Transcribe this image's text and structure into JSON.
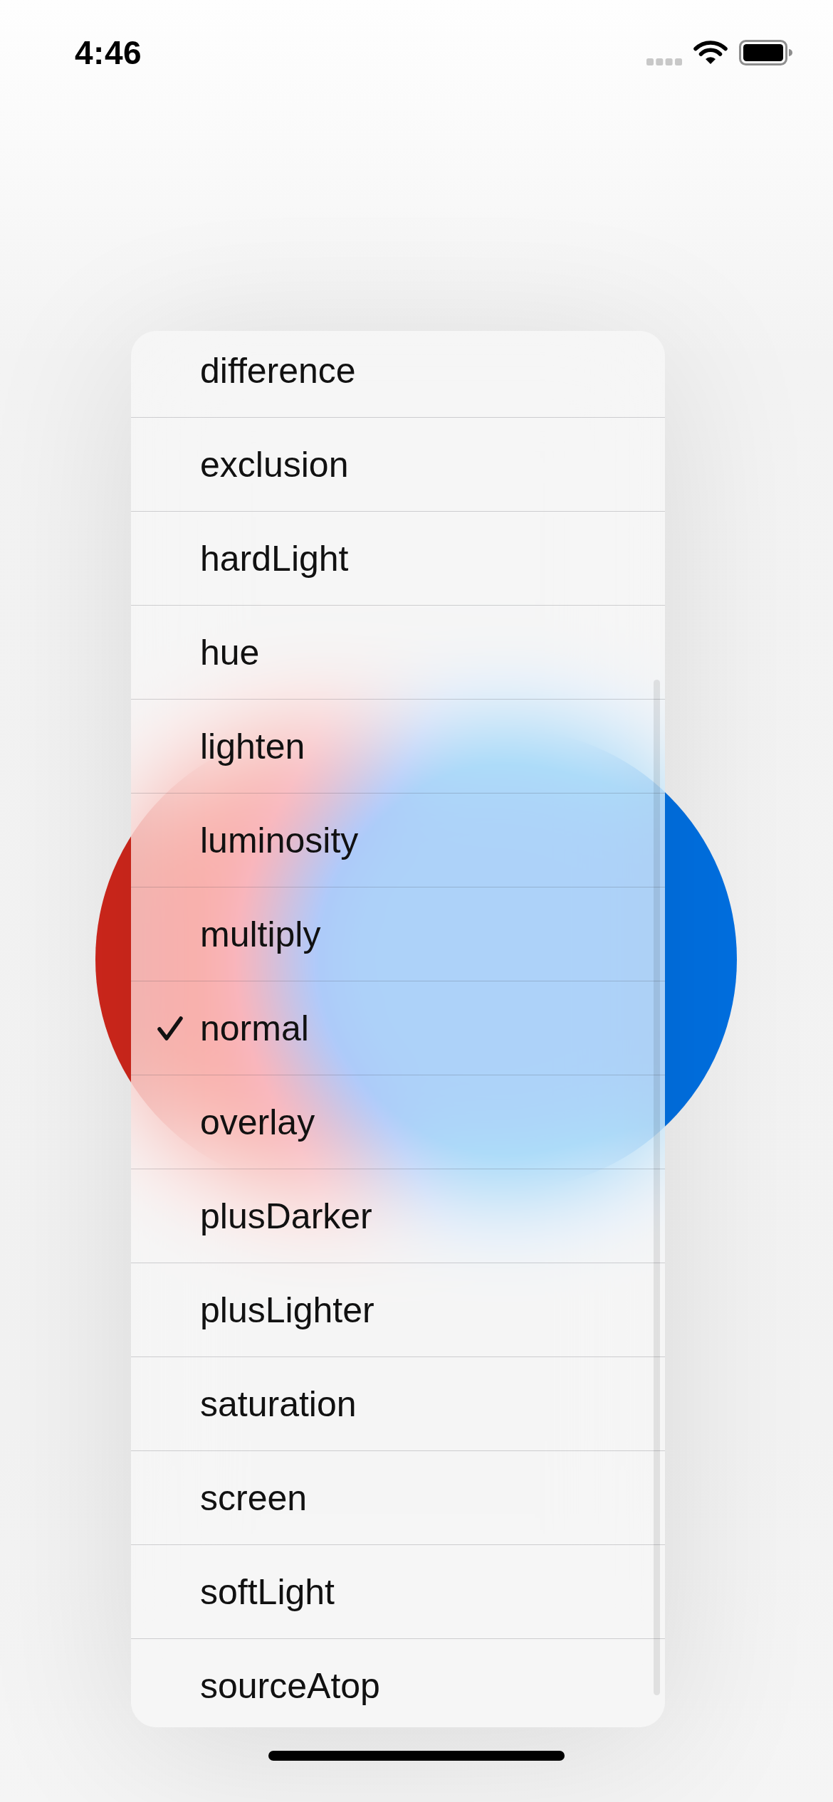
{
  "status_bar": {
    "time": "4:46"
  },
  "menu": {
    "items": [
      {
        "label": "difference",
        "selected": false
      },
      {
        "label": "exclusion",
        "selected": false
      },
      {
        "label": "hardLight",
        "selected": false
      },
      {
        "label": "hue",
        "selected": false
      },
      {
        "label": "lighten",
        "selected": false
      },
      {
        "label": "luminosity",
        "selected": false
      },
      {
        "label": "multiply",
        "selected": false
      },
      {
        "label": "normal",
        "selected": true
      },
      {
        "label": "overlay",
        "selected": false
      },
      {
        "label": "plusDarker",
        "selected": false
      },
      {
        "label": "plusLighter",
        "selected": false
      },
      {
        "label": "saturation",
        "selected": false
      },
      {
        "label": "screen",
        "selected": false
      },
      {
        "label": "softLight",
        "selected": false
      },
      {
        "label": "sourceAtop",
        "selected": false
      }
    ]
  }
}
